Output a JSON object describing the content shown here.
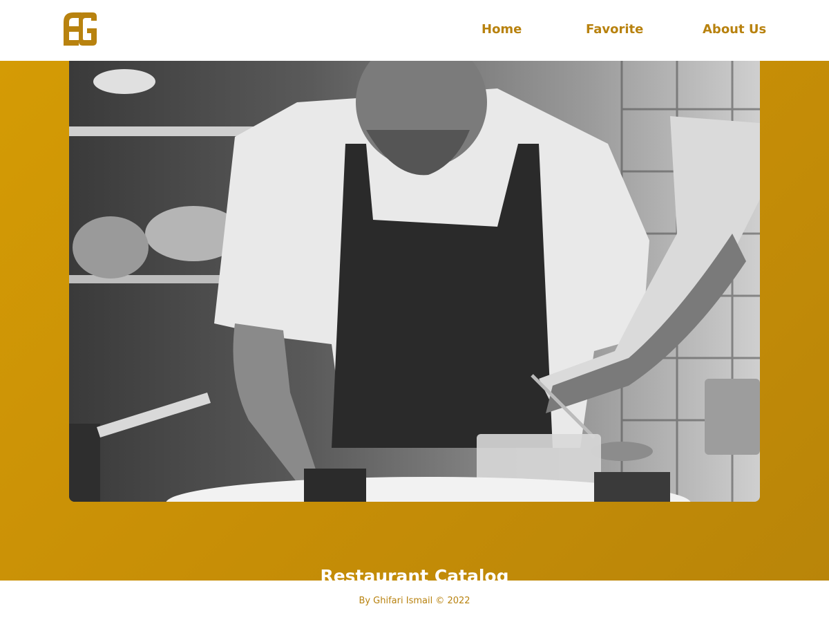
{
  "brand": {
    "logo_icon": "eg-monogram-logo",
    "accent_color": "#B8820F"
  },
  "nav": {
    "items": [
      "Home",
      "Favorite",
      "About Us"
    ]
  },
  "hero": {
    "title": "Restaurant Catalog",
    "image_description_icon": "chef-plating-photo",
    "background_color": "#C88F06"
  },
  "footer": {
    "text": "By Ghifari Ismail © 2022"
  }
}
